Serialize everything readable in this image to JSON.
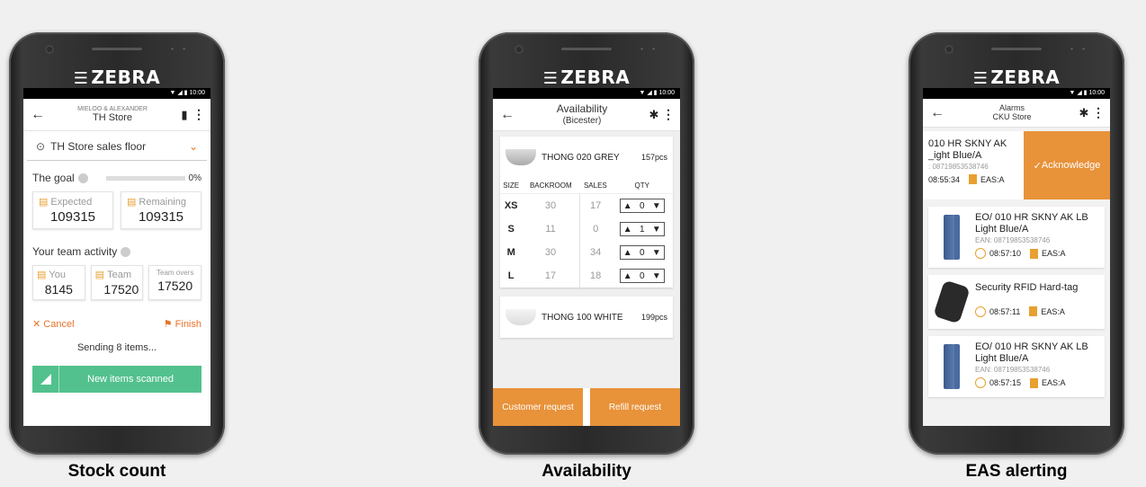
{
  "captions": [
    "Stock count",
    "Availability",
    "EAS alerting"
  ],
  "brand": "ZEBRA",
  "status_time": "10:00",
  "stock_count": {
    "header": {
      "brand_small": "MIELOO & ALEXANDER",
      "store": "TH Store"
    },
    "location": "TH Store sales floor",
    "goal": {
      "label": "The goal",
      "percent": "0%",
      "progress": 0
    },
    "expected": {
      "label": "Expected",
      "value": "109315"
    },
    "remaining": {
      "label": "Remaining",
      "value": "109315"
    },
    "team_activity_label": "Your team activity",
    "you": {
      "label": "You",
      "value": "8145"
    },
    "team": {
      "label": "Team",
      "value": "17520"
    },
    "team_overs": {
      "label": "Team overs",
      "value": "17520"
    },
    "cancel": "Cancel",
    "finish": "Finish",
    "sending": "Sending 8 items...",
    "new_items": "New items scanned"
  },
  "availability": {
    "title": "Availability",
    "subtitle": "(Bicester)",
    "product1": {
      "name": "THONG 020 GREY",
      "pcs": "157pcs"
    },
    "columns": [
      "SIZE",
      "BACKROOM",
      "SALES",
      "QTY"
    ],
    "rows": [
      {
        "size": "XS",
        "backroom": "30",
        "sales": "17",
        "qty": "0"
      },
      {
        "size": "S",
        "backroom": "11",
        "sales": "0",
        "qty": "1"
      },
      {
        "size": "M",
        "backroom": "30",
        "sales": "34",
        "qty": "0"
      },
      {
        "size": "L",
        "backroom": "17",
        "sales": "18",
        "qty": "0"
      }
    ],
    "product2": {
      "name": "THONG 100 WHITE",
      "pcs": "199pcs"
    },
    "customer_request": "Customer request",
    "refill_request": "Refill request"
  },
  "eas": {
    "title": "Alarms",
    "subtitle": "CKU Store",
    "alarm1": {
      "title_line1": "010 HR SKNY AK",
      "title_line2": "_ight Blue/A",
      "ean": ": 08719853538746",
      "time": "08:55:34",
      "eas": "EAS:A"
    },
    "acknowledge": "Acknowledge",
    "items": [
      {
        "title": "EO/ 010 HR SKNY AK LB Light Blue/A",
        "ean": "EAN: 08719853538746",
        "time": "08:57:10",
        "eas": "EAS:A",
        "kind": "jeans"
      },
      {
        "title": "Security RFID Hard-tag",
        "ean": "",
        "time": "08:57:11",
        "eas": "EAS:A",
        "kind": "tag"
      },
      {
        "title": "EO/ 010 HR SKNY AK LB Light Blue/A",
        "ean": "EAN: 08719853538746",
        "time": "08:57:15",
        "eas": "EAS:A",
        "kind": "jeans"
      }
    ]
  }
}
